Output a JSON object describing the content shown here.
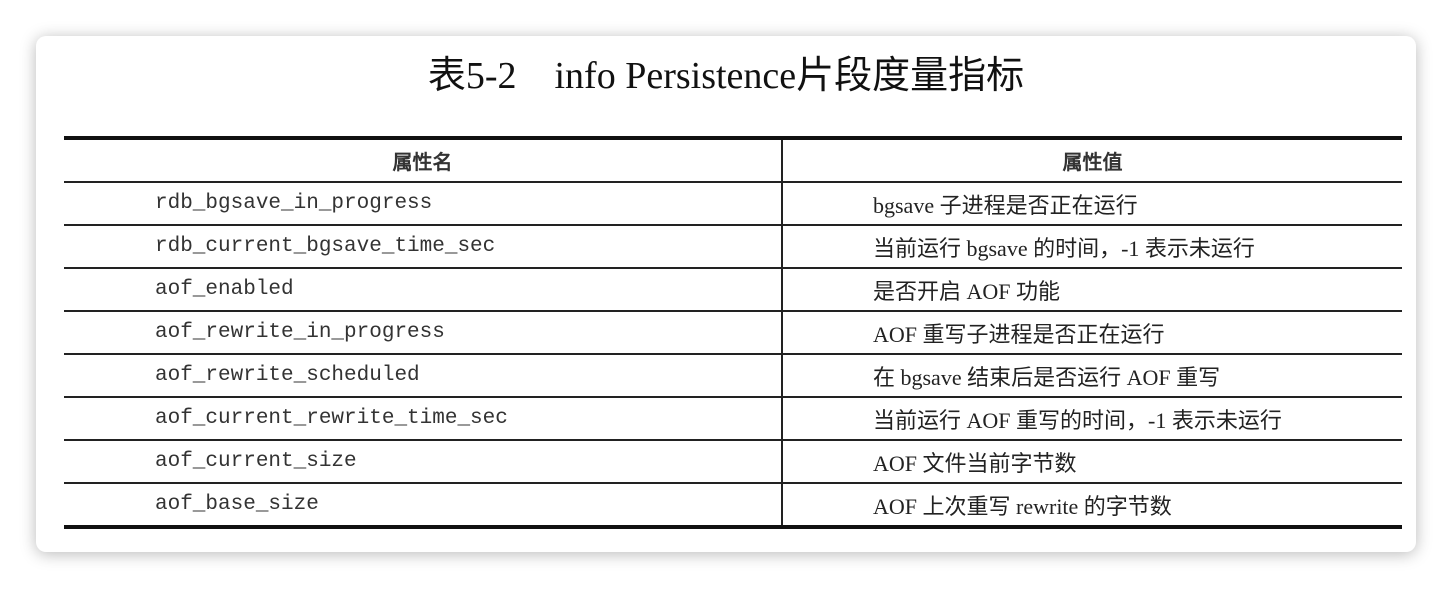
{
  "title": "表5-2    info Persistence片段度量指标",
  "table": {
    "headers": [
      "属性名",
      "属性值"
    ],
    "rows": [
      [
        "rdb_bgsave_in_progress",
        "bgsave 子进程是否正在运行"
      ],
      [
        "rdb_current_bgsave_time_sec",
        "当前运行 bgsave 的时间，-1 表示未运行"
      ],
      [
        "aof_enabled",
        "是否开启 AOF 功能"
      ],
      [
        "aof_rewrite_in_progress",
        "AOF 重写子进程是否正在运行"
      ],
      [
        "aof_rewrite_scheduled",
        "在 bgsave 结束后是否运行 AOF 重写"
      ],
      [
        "aof_current_rewrite_time_sec",
        "当前运行 AOF 重写的时间，-1 表示未运行"
      ],
      [
        "aof_current_size",
        "AOF 文件当前字节数"
      ],
      [
        "aof_base_size",
        "AOF 上次重写 rewrite 的字节数"
      ]
    ]
  }
}
